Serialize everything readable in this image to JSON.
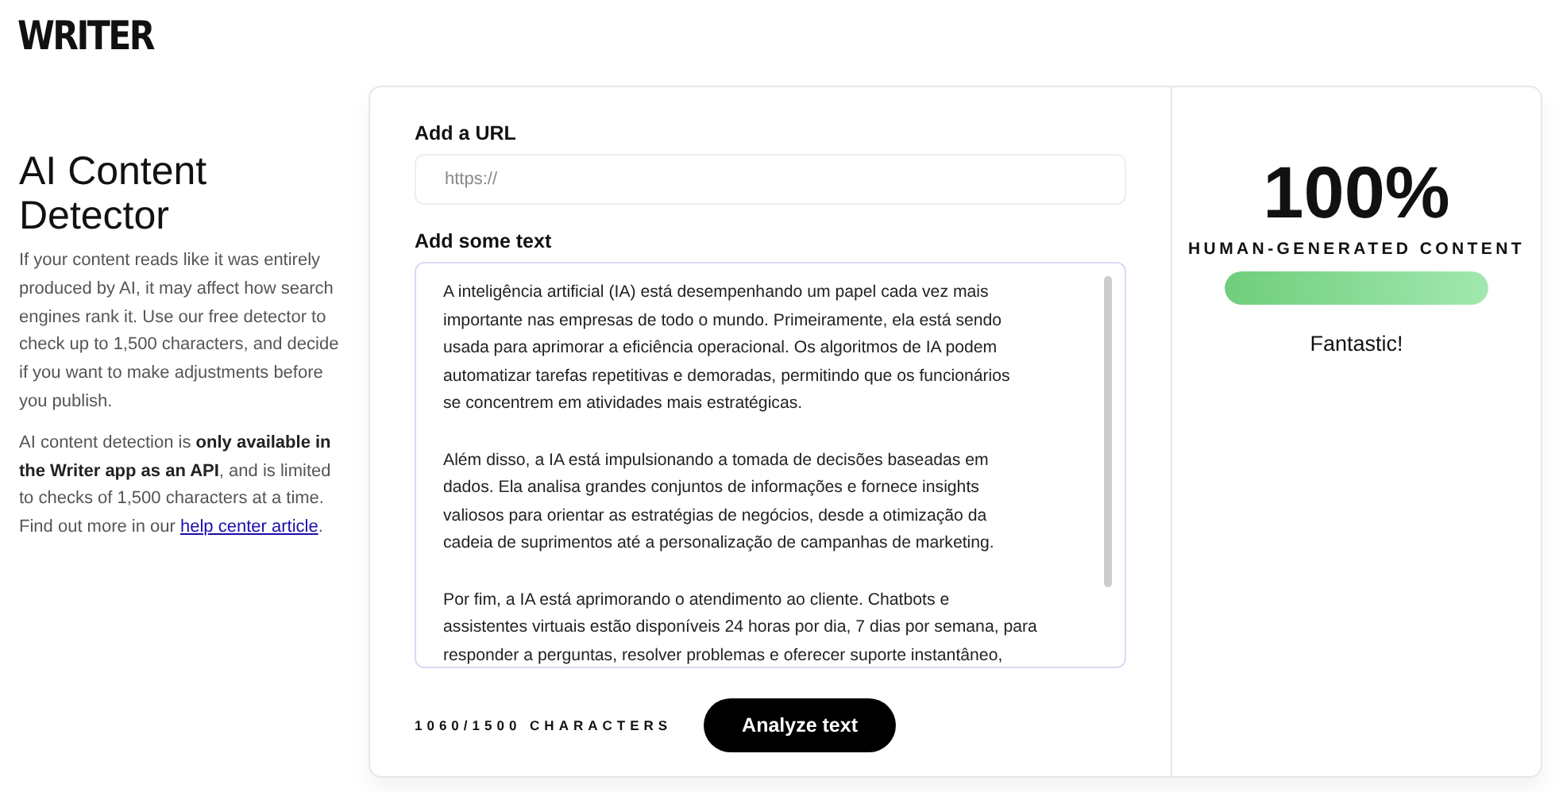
{
  "logo": "WRITER",
  "intro": {
    "title": "AI Content Detector",
    "paragraphs": [
      "If your content reads like it was entirely produced by AI, it may affect how search engines rank it. Use our free detector to check up to 1,500 characters, and decide if you want to make adjustments before you publish.",
      "AI content detection is **only available in the Writer app as an API**, and is limited to checks of 1,500 characters at a time. Find out more in our"
    ],
    "link": "help center article",
    "after_link": "."
  },
  "url_field": {
    "label": "Add a URL",
    "placeholder": "https://"
  },
  "text_field": {
    "label": "Add some text",
    "paragraphs": [
      [
        "A inteligência artificial (IA) está desempenhando um papel cada vez mais",
        "importante nas empresas de todo o mundo. Primeiramente, ela está sendo",
        "usada para aprimorar a eficiência operacional. Os algoritmos de IA podem",
        "automatizar tarefas repetitivas e demoradas, permitindo que os funcionários",
        "se concentrem em atividades mais estratégicas."
      ],
      [
        "Além disso, a IA está impulsionando a tomada de decisões baseadas em",
        "dados. Ela analisa grandes conjuntos de informações e fornece insights",
        "valiosos para orientar as estratégias de negócios, desde a otimização da",
        "cadeia de suprimentos até a personalização de campanhas de marketing."
      ],
      [
        "Por fim, a IA está aprimorando o atendimento ao cliente. Chatbots e",
        "assistentes virtuais estão disponíveis 24 horas por dia, 7 dias por semana, para",
        "responder a perguntas, resolver problemas e oferecer suporte instantâneo,"
      ]
    ]
  },
  "char_count": "1060/1500 CHARACTERS",
  "analyze_button": "Analyze text",
  "result": {
    "score": "100%",
    "caption": "HUMAN-GENERATED CONTENT",
    "level": 1,
    "verdict": "Fantastic!"
  }
}
